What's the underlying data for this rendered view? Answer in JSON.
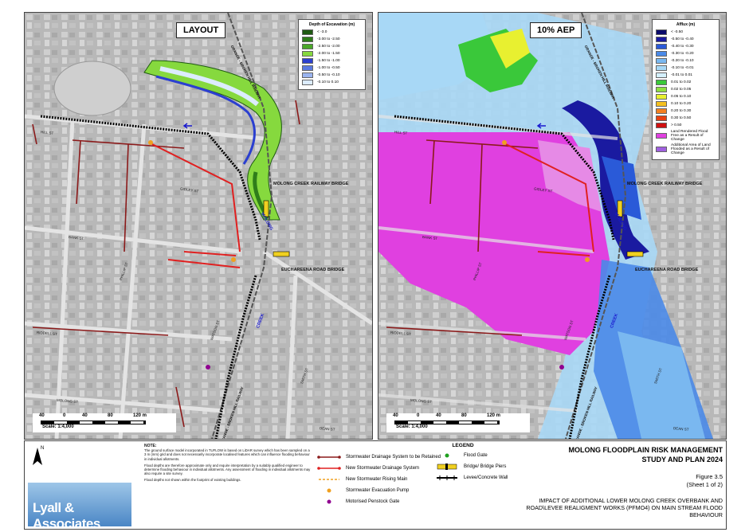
{
  "panels": {
    "left": {
      "title": "LAYOUT",
      "legend_title": "Depth of Excavation (m)",
      "legend": [
        {
          "label": "< -3.0",
          "color": "#1f5a12"
        },
        {
          "label": "-3.00 to -2.50",
          "color": "#2f7d1a"
        },
        {
          "label": "-2.50 to -2.00",
          "color": "#4aa829"
        },
        {
          "label": "-2.00 to -1.50",
          "color": "#86d93e"
        },
        {
          "label": "-1.50 to -1.00",
          "color": "#2b3fd0"
        },
        {
          "label": "-1.00 to -0.50",
          "color": "#5a79e0"
        },
        {
          "label": "-0.50 to -0.10",
          "color": "#9ab4f0"
        },
        {
          "label": "-0.10 to 0.10",
          "color": "#dcecff"
        }
      ]
    },
    "right": {
      "title": "10% AEP",
      "legend_title": "Afflux (m)",
      "legend": [
        {
          "label": "< -0.50",
          "color": "#0a0a6a"
        },
        {
          "label": "-0.50 to -0.40",
          "color": "#1a1aa0"
        },
        {
          "label": "-0.40 to -0.30",
          "color": "#2a5ad8"
        },
        {
          "label": "-0.30 to -0.20",
          "color": "#4a8ae8"
        },
        {
          "label": "-0.20 to -0.10",
          "color": "#7ab8f0"
        },
        {
          "label": "-0.10 to -0.01",
          "color": "#a8d8f6"
        },
        {
          "label": "-0.01 to 0.01",
          "color": "#d4f0ff"
        },
        {
          "label": "0.01 to 0.02",
          "color": "#3ac83a"
        },
        {
          "label": "0.02 to 0.05",
          "color": "#8ee040"
        },
        {
          "label": "0.05 to 0.10",
          "color": "#e8f030"
        },
        {
          "label": "0.10 to 0.20",
          "color": "#f4c020"
        },
        {
          "label": "0.20 to 0.30",
          "color": "#f48020"
        },
        {
          "label": "0.30 to 0.50",
          "color": "#e84010"
        },
        {
          "label": "> 0.50",
          "color": "#d01010"
        },
        {
          "label": "Land Rendered Flood Free as a Result of Change",
          "color": "#e040e0"
        },
        {
          "label": "Additional Area of Land Flooded as a Result of Change",
          "color": "#a060e0"
        }
      ]
    }
  },
  "map_labels": {
    "rail_north": "ORANGE - BROKEN HILL RAILWAY",
    "rail_south": "ORANGE - BROKEN HILL RAILWAY",
    "bridge1": "MOLONG CREEK RAILWAY BRIDGE",
    "bridge2": "EUCHAREENA ROAD BRIDGE",
    "creek1": "MOLONG",
    "creek2": "CREEK",
    "hill_st": "HILL ST",
    "gidley_st": "GIDLEY ST",
    "bank_st": "BANK ST",
    "riddell_st": "RIDDELL ST",
    "molong_st": "MOLONG ST",
    "dean_st": "DEAN ST",
    "watson_st": "WATSON ST",
    "phillip_st": "PHILLIP ST",
    "smith_st": "SMITH ST"
  },
  "scale": {
    "ticks": [
      "40",
      "0",
      "40",
      "80",
      "120 m"
    ],
    "text": "Scale: 1:4,000"
  },
  "north": "N",
  "logo": "Lyall & Associates",
  "note": {
    "title": "NOTE:",
    "p1": "The ground surface model incorporated in TUFLOW is based on LiDAR survey which has been sampled on a 3 m (mm) grid and does not necessarily incorporate localised features which can influence flooding behaviour in individual allotments.",
    "p2": "Flood depths are therefore approximate only and require interpretation by a suitably qualified engineer to determine flooding behaviour in individual allotments. Any assessment of flooding in individual allotments may also require a site survey.",
    "p3": "Flood depths not shown within the footprint of existing buildings."
  },
  "legend_main": {
    "title": "LEGEND",
    "items": [
      "Stormwater Drainage System to be Retained",
      "New Stormwater Drainage System",
      "New Stormwater Rising Main",
      "Stormwater Evacuation Pump",
      "Motorised Penstock Gate",
      "Flood Gate",
      "Bridge/ Bridge Piers",
      "Levee/Concrete Wall"
    ]
  },
  "title_block": {
    "line1": "MOLONG FLOODPLAIN RISK MANAGEMENT",
    "line2": "STUDY AND PLAN 2024",
    "figure": "Figure 3.5",
    "sheet": "(Sheet 1 of 2)",
    "description": "IMPACT OF ADDITIONAL LOWER MOLONG CREEK OVERBANK AND ROAD\\LEVEE REALIGMENT WORKS (PFMO4) ON MAIN STREAM FLOOD BEHAVIOUR"
  }
}
